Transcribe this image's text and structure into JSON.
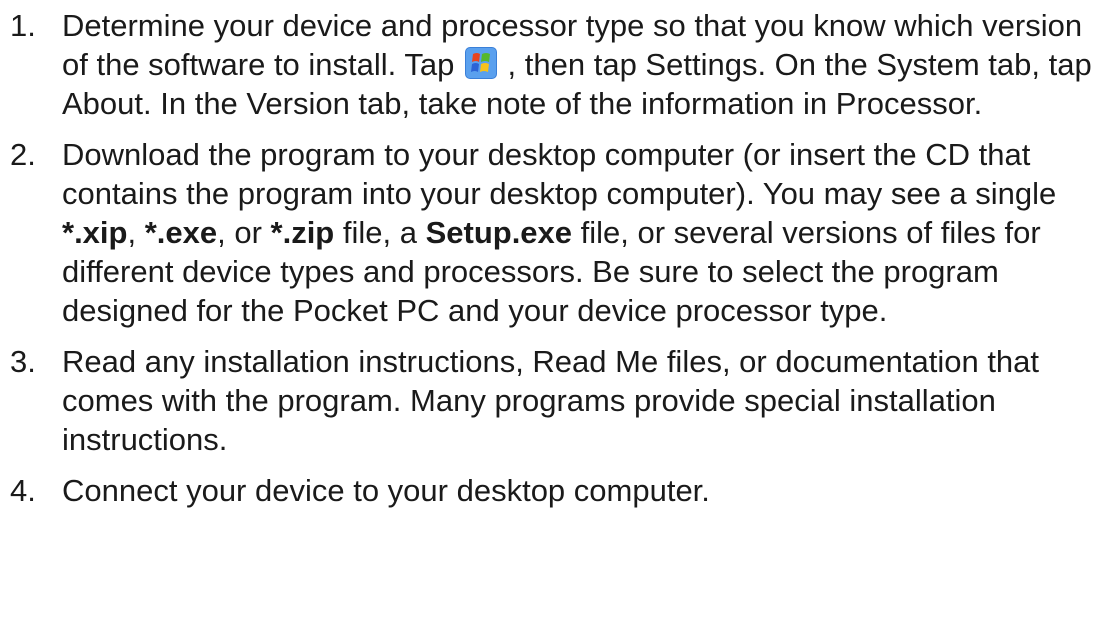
{
  "steps": [
    {
      "number": "1.",
      "parts": [
        {
          "t": "Determine your device and processor type so that you know which version of the software to install. Tap "
        },
        {
          "icon": "windows-start-icon"
        },
        {
          "t": " , then tap Settings. On the System tab, tap About. In the Version tab, take note of the information in Processor."
        }
      ]
    },
    {
      "number": "2.",
      "parts": [
        {
          "t": "Download the program to your desktop computer (or insert the CD that contains the program into your desktop computer). You may see a single "
        },
        {
          "b": "*.xip"
        },
        {
          "t": ", "
        },
        {
          "b": "*.exe"
        },
        {
          "t": ", or "
        },
        {
          "b": "*.zip"
        },
        {
          "t": " file, a "
        },
        {
          "b": "Setup.exe"
        },
        {
          "t": " file, or several versions of files for different device types and processors. Be sure to select the program designed for the Pocket PC and your device processor type."
        }
      ]
    },
    {
      "number": "3.",
      "parts": [
        {
          "t": "Read any installation instructions, Read Me files, or documentation that comes with the program. Many programs provide special installation instructions."
        }
      ]
    },
    {
      "number": "4.",
      "parts": [
        {
          "t": "Connect your device to your desktop computer."
        }
      ]
    }
  ]
}
